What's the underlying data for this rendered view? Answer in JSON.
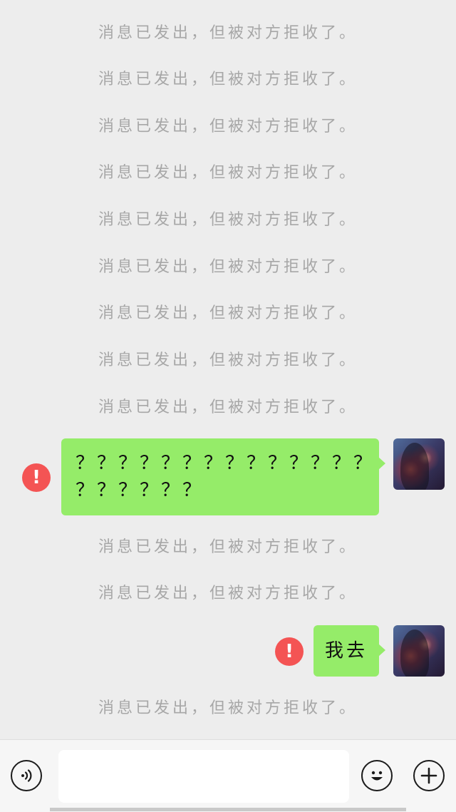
{
  "system_notice_text": "消息已发出，但被对方拒收了。",
  "messages": [
    {
      "text": "？？？？？？？？？？？？？？？？？？？？？",
      "line1": "？？？？？？？？？？？？？？",
      "line2": "？？？？？？",
      "status": "failed"
    },
    {
      "text": "我去",
      "status": "failed"
    }
  ],
  "error_symbol": "!",
  "input": {
    "value": "",
    "placeholder": ""
  },
  "icons": {
    "voice": "voice-icon",
    "emoji": "emoji-icon",
    "more": "plus-icon",
    "error": "error-icon",
    "avatar": "avatar"
  },
  "colors": {
    "background": "#ededed",
    "bubble_sent": "#95ec69",
    "error": "#f45454",
    "system_text": "#a7a7a7"
  }
}
